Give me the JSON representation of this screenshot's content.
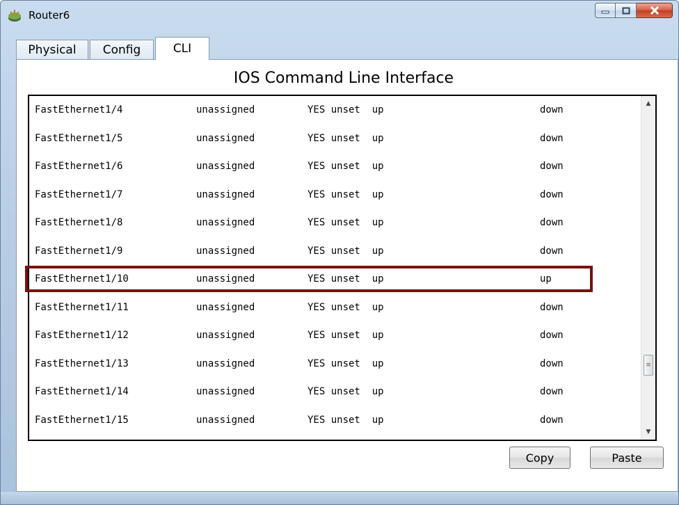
{
  "window": {
    "title": "Router6",
    "icon": "router-icon",
    "controls": {
      "minimize_icon": "minimize-icon",
      "maximize_icon": "maximize-icon",
      "close_icon": "close-icon"
    }
  },
  "tabs": [
    {
      "label": "Physical",
      "active": false
    },
    {
      "label": "Config",
      "active": false
    },
    {
      "label": "CLI",
      "active": true
    }
  ],
  "panel": {
    "title": "IOS Command Line Interface"
  },
  "terminal": {
    "rows": [
      {
        "interface": "FastEthernet1/4",
        "ip": "unassigned",
        "ok_method": "YES unset  up",
        "protocol": "down"
      },
      {
        "interface": "FastEthernet1/5",
        "ip": "unassigned",
        "ok_method": "YES unset  up",
        "protocol": "down"
      },
      {
        "interface": "FastEthernet1/6",
        "ip": "unassigned",
        "ok_method": "YES unset  up",
        "protocol": "down"
      },
      {
        "interface": "FastEthernet1/7",
        "ip": "unassigned",
        "ok_method": "YES unset  up",
        "protocol": "down"
      },
      {
        "interface": "FastEthernet1/8",
        "ip": "unassigned",
        "ok_method": "YES unset  up",
        "protocol": "down"
      },
      {
        "interface": "FastEthernet1/9",
        "ip": "unassigned",
        "ok_method": "YES unset  up",
        "protocol": "down"
      },
      {
        "interface": "FastEthernet1/10",
        "ip": "unassigned",
        "ok_method": "YES unset  up",
        "protocol": "up"
      },
      {
        "interface": "FastEthernet1/11",
        "ip": "unassigned",
        "ok_method": "YES unset  up",
        "protocol": "down"
      },
      {
        "interface": "FastEthernet1/12",
        "ip": "unassigned",
        "ok_method": "YES unset  up",
        "protocol": "down"
      },
      {
        "interface": "FastEthernet1/13",
        "ip": "unassigned",
        "ok_method": "YES unset  up",
        "protocol": "down"
      },
      {
        "interface": "FastEthernet1/14",
        "ip": "unassigned",
        "ok_method": "YES unset  up",
        "protocol": "down"
      },
      {
        "interface": "FastEthernet1/15",
        "ip": "unassigned",
        "ok_method": "YES unset  up",
        "protocol": "down"
      }
    ],
    "highlight_color": "#7a1010"
  },
  "buttons": {
    "copy": "Copy",
    "paste": "Paste"
  }
}
